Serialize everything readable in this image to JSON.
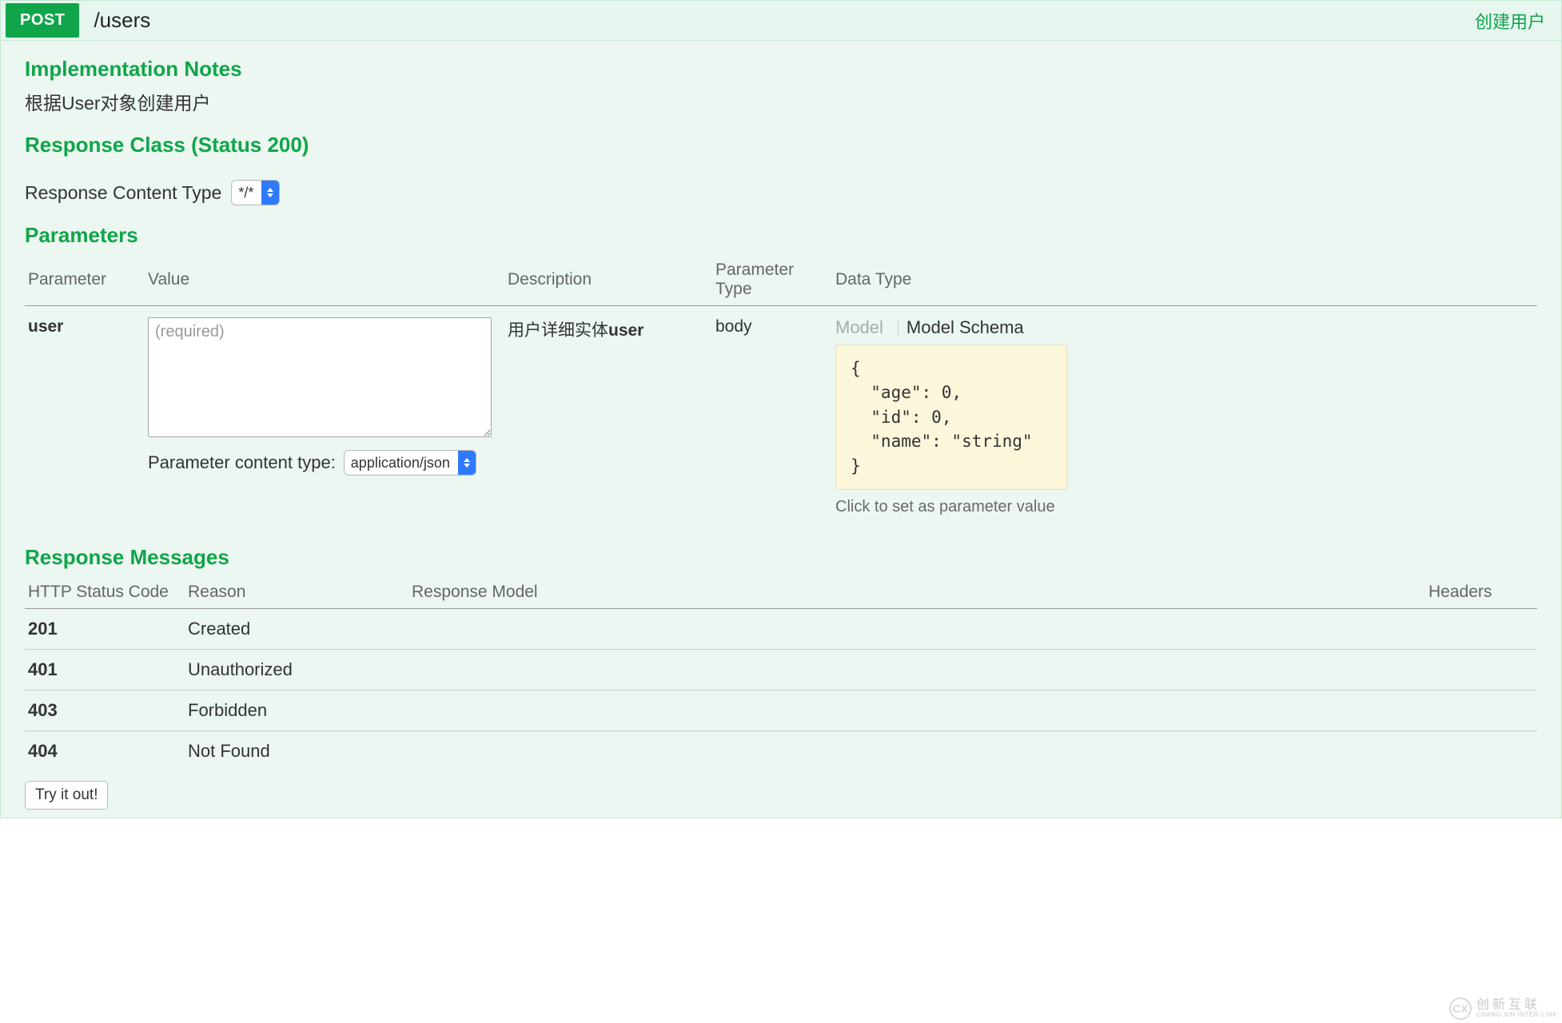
{
  "operation": {
    "method": "POST",
    "path": "/users",
    "summary": "创建用户"
  },
  "implementation_notes": {
    "heading": "Implementation Notes",
    "text": "根据User对象创建用户"
  },
  "response_class": {
    "heading": "Response Class (Status 200)"
  },
  "response_content_type": {
    "label": "Response Content Type",
    "value": "*/*"
  },
  "parameters": {
    "heading": "Parameters",
    "columns": {
      "parameter": "Parameter",
      "value": "Value",
      "description": "Description",
      "parameter_type": "Parameter Type",
      "data_type": "Data Type"
    },
    "rows": [
      {
        "name": "user",
        "value_placeholder": "(required)",
        "parameter_content_type_label": "Parameter content type:",
        "parameter_content_type_value": "application/json",
        "description_prefix": "用户详细实体",
        "description_bold": "user",
        "parameter_type": "body",
        "data_type_tabs": {
          "model": "Model",
          "model_schema": "Model Schema"
        },
        "model_schema": "{\n  \"age\": 0,\n  \"id\": 0,\n  \"name\": \"string\"\n}",
        "click_hint": "Click to set as parameter value"
      }
    ]
  },
  "response_messages": {
    "heading": "Response Messages",
    "columns": {
      "code": "HTTP Status Code",
      "reason": "Reason",
      "model": "Response Model",
      "headers": "Headers"
    },
    "rows": [
      {
        "code": "201",
        "reason": "Created"
      },
      {
        "code": "401",
        "reason": "Unauthorized"
      },
      {
        "code": "403",
        "reason": "Forbidden"
      },
      {
        "code": "404",
        "reason": "Not Found"
      }
    ]
  },
  "actions": {
    "try_it_out": "Try it out!"
  },
  "watermark": {
    "letters": "CX",
    "text_top": "创新互联",
    "text_bottom": "CHANG XIN INTER-LINK"
  }
}
